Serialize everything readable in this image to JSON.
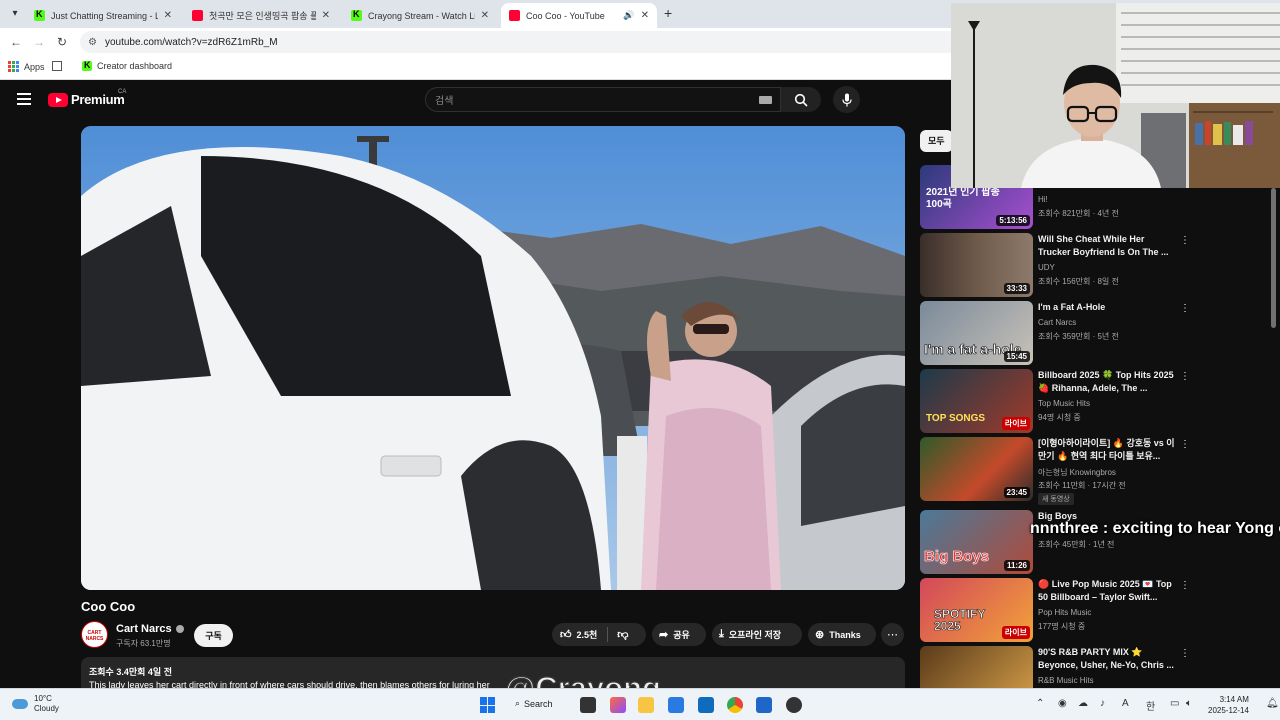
{
  "browser": {
    "tabs": [
      {
        "title": "Just Chatting Streaming - Live S",
        "favicon": "kick-icon",
        "active": false
      },
      {
        "title": "첫곡만 모은 인생띵곡 팝송 플레",
        "favicon": "youtube-icon",
        "active": false
      },
      {
        "title": "Crayong Stream - Watch Live o",
        "favicon": "kick-icon",
        "active": false
      },
      {
        "title": "Coo Coo - YouTube",
        "favicon": "youtube-icon",
        "active": true
      }
    ],
    "url": "youtube.com/watch?v=zdR6Z1mRb_M",
    "bookmarks": [
      {
        "label": "Apps"
      },
      {
        "label": "Creator dashboard"
      }
    ]
  },
  "youtube": {
    "logo": "Premium",
    "country": "CA",
    "search_placeholder": "검색"
  },
  "video": {
    "title": "Coo Coo",
    "channel": "Cart Narcs",
    "subscribers": "구독자 63.1만명",
    "subscribe_label": "구독",
    "likes": "2.5천",
    "share_label": "공유",
    "download_label": "오프라인 저장",
    "thanks_label": "Thanks",
    "views_date": "조회수 3.4만회  4일 전",
    "description": "This lady leaves her cart directly in front of where cars should drive, then blames others for luring her",
    "avatar_text": "CART NARCS"
  },
  "sidebar": {
    "chip": "모두",
    "items": [
      {
        "title": "",
        "channel": "Hi!",
        "meta": "조회수 821만회 · 4년 전",
        "duration": "5:13:56",
        "thumb_text": "2021년 인기 팝송 100곡"
      },
      {
        "title": "Will She Cheat While Her Trucker Boyfriend Is On The ...",
        "channel": "UDY",
        "meta": "조회수 156만회 · 8일 전",
        "duration": "33:33"
      },
      {
        "title": "I'm a Fat A-Hole",
        "channel": "Cart Narcs",
        "meta": "조회수 359만회 · 5년 전",
        "duration": "15:45",
        "thumb_text": "I'm a fat a-hole"
      },
      {
        "title": "Billboard 2025 🍀 Top Hits 2025 🍓 Rihanna, Adele, The ...",
        "channel": "Top Music Hits",
        "meta": "94명 시청 중",
        "duration": "라이브",
        "thumb_text": "TOP SONGS"
      },
      {
        "title": "[이형아하이라이트] 🔥 강호동 vs 이만기 🔥 현역 최다 타이틀 보유...",
        "channel": "아는형님 Knowingbros",
        "meta": "조회수 11만회 · 17시간 전",
        "duration": "23:45",
        "badge": "새 동영상"
      },
      {
        "title": "Big Boys",
        "channel": "",
        "meta": "조회수 45만회 · 1년 전",
        "duration": "11:26",
        "thumb_text": "Big Boys"
      },
      {
        "title": "🔴 Live Pop Music 2025 💌 Top 50 Billboard – Taylor Swift...",
        "channel": "Pop Hits Music",
        "meta": "177명 시청 중",
        "duration": "라이브",
        "thumb_text": "SPOTIFY 2025"
      },
      {
        "title": "90'S R&B PARTY MIX ⭐ Beyonce, Usher, Ne-Yo, Chris ...",
        "channel": "R&B Music Hits",
        "meta": "",
        "duration": ""
      }
    ]
  },
  "overlay": {
    "chat_text": "nnnthree : exciting to hear Yong opinion",
    "watermark": "@Crayong"
  },
  "taskbar": {
    "weather_temp": "10°C",
    "weather_desc": "Cloudy",
    "search_label": "Search",
    "time": "3:14 AM",
    "date": "2025-12-14"
  },
  "colors": {
    "yt_red": "#ff0033",
    "kick_green": "#53fc18",
    "yt_bg": "#0f0f0f"
  }
}
